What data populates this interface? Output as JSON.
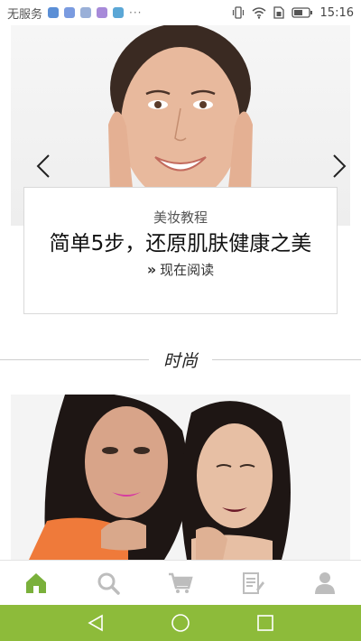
{
  "status_bar": {
    "carrier": "无服务",
    "more": "···",
    "time": "15:16",
    "app_icons": [
      {
        "name": "chat-app-icon",
        "color": "#5b8fd6"
      },
      {
        "name": "photo-app-icon",
        "color": "#7a9be0"
      },
      {
        "name": "gallery-app-icon",
        "color": "#9ab0d8"
      },
      {
        "name": "message-app-icon",
        "color": "#a78ad9"
      },
      {
        "name": "shield-app-icon",
        "color": "#5ba7d6"
      }
    ]
  },
  "hero": {
    "category": "美妆教程",
    "title": "简单5步，还原肌肤健康之美",
    "read_more": "现在阅读",
    "prev_icon": "chevron-left-icon",
    "next_icon": "chevron-right-icon"
  },
  "section": {
    "title": "时尚"
  },
  "tabbar": {
    "items": [
      {
        "name": "home-icon",
        "active": true
      },
      {
        "name": "search-icon",
        "active": false
      },
      {
        "name": "cart-icon",
        "active": false
      },
      {
        "name": "notes-icon",
        "active": false
      },
      {
        "name": "profile-icon",
        "active": false
      }
    ],
    "active_color": "#7ab03b",
    "inactive_color": "#bdbdbd"
  },
  "navbar": {
    "color": "#8dbb3a",
    "buttons": [
      "back-icon",
      "home-circle-icon",
      "recents-icon"
    ]
  }
}
